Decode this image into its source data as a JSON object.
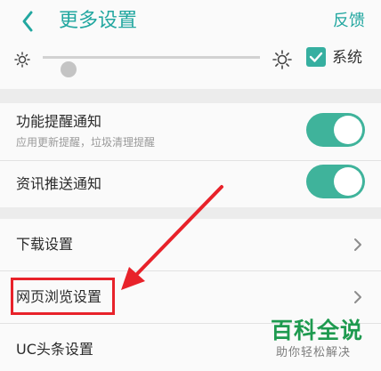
{
  "header": {
    "title": "更多设置",
    "feedback": "反馈"
  },
  "brightness": {
    "level": 0.12,
    "system_checked": true,
    "system_label": "系统"
  },
  "notifications": [
    {
      "label": "功能提醒通知",
      "sub": "应用更新提醒，垃圾清理提醒",
      "enabled": true
    },
    {
      "label": "资讯推送通知",
      "enabled": true
    }
  ],
  "settings_list": [
    {
      "label": "下载设置"
    },
    {
      "label": "网页浏览设置"
    },
    {
      "label": "UC头条设置"
    }
  ],
  "watermark": {
    "main": "百科全说",
    "sub": "助你轻松解决"
  },
  "colors": {
    "accent": "#22a7a0",
    "toggle_on": "#3fb39b",
    "highlight": "#e8222a",
    "watermark": "#1e9a4f"
  }
}
